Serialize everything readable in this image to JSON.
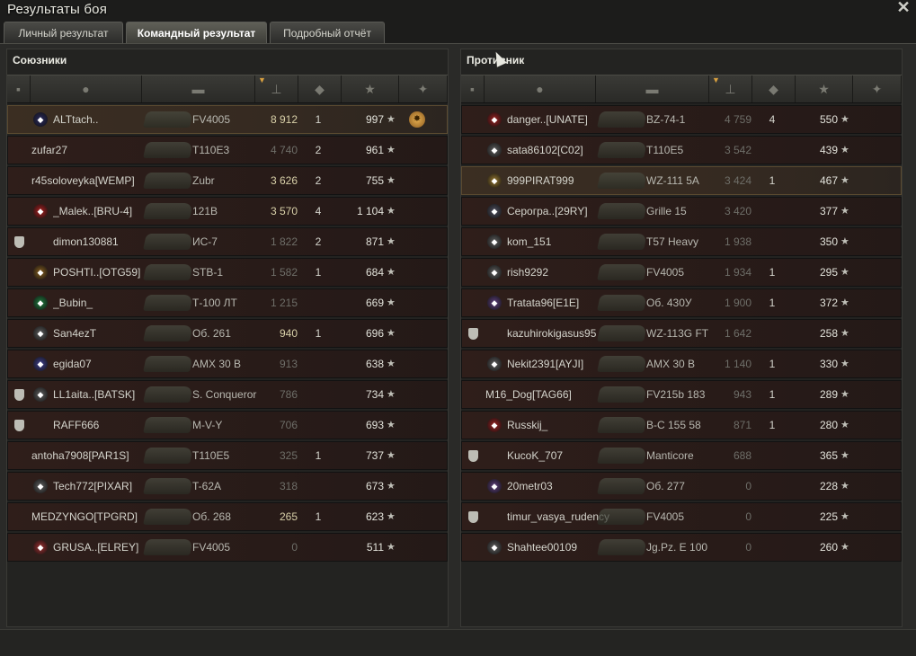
{
  "window": {
    "title": "Результаты боя",
    "close_icon": "close-icon"
  },
  "tabs": [
    {
      "label": "Личный результат",
      "active": false
    },
    {
      "label": "Командный результат",
      "active": true
    },
    {
      "label": "Подробный отчёт",
      "active": false
    }
  ],
  "allies": {
    "title": "Союзники",
    "rows": [
      {
        "squad": "",
        "clan_color": "#2a2a60",
        "name": "ALTtach..",
        "tank": "FV4005",
        "damage": "8 912",
        "kills": "1",
        "xp": "997",
        "medal": true,
        "dmg_bright": true,
        "highlight": true
      },
      {
        "squad": "",
        "clan_color": "",
        "name": "zufar27",
        "tank": "T110E3",
        "damage": "4 740",
        "kills": "2",
        "xp": "961",
        "medal": false,
        "dmg_bright": false
      },
      {
        "squad": "",
        "clan_color": "",
        "name": "r45soloveyka[WEMP]",
        "tank": "Zubr",
        "damage": "3 626",
        "kills": "2",
        "xp": "755",
        "medal": false,
        "dmg_bright": true
      },
      {
        "squad": "",
        "clan_color": "#b02020",
        "name": "_Malek..[BRU-4]",
        "tank": "121B",
        "damage": "3 570",
        "kills": "4",
        "xp": "1 104",
        "medal": false,
        "dmg_bright": true
      },
      {
        "squad": "sq",
        "clan_color": "",
        "name": "dimon130881",
        "tank": "ИС-7",
        "damage": "1 822",
        "kills": "2",
        "xp": "871",
        "medal": false,
        "dmg_bright": false
      },
      {
        "squad": "",
        "clan_color": "#8a6020",
        "name": "POSHTI..[OTG59]",
        "tank": "STB-1",
        "damage": "1 582",
        "kills": "1",
        "xp": "684",
        "medal": false,
        "dmg_bright": false
      },
      {
        "squad": "",
        "clan_color": "#208040",
        "name": "_Bubin_",
        "tank": "Т-100 ЛТ",
        "damage": "1 215",
        "kills": "",
        "xp": "669",
        "medal": false,
        "dmg_bright": false
      },
      {
        "squad": "",
        "clan_color": "#606060",
        "name": "San4ezT",
        "tank": "Об. 261",
        "damage": "940",
        "kills": "1",
        "xp": "696",
        "medal": false,
        "dmg_bright": true
      },
      {
        "squad": "",
        "clan_color": "#404090",
        "name": "egida07",
        "tank": "AMX 30 B",
        "damage": "913",
        "kills": "",
        "xp": "638",
        "medal": false,
        "dmg_bright": false
      },
      {
        "squad": "sq",
        "clan_color": "#606060",
        "name": "LL1aita..[BATSK]",
        "tank": "S. Conqueror",
        "damage": "786",
        "kills": "",
        "xp": "734",
        "medal": false,
        "dmg_bright": false
      },
      {
        "squad": "sq",
        "clan_color": "",
        "name": "RAFF666",
        "tank": "M-V-Y",
        "damage": "706",
        "kills": "",
        "xp": "693",
        "medal": false,
        "dmg_bright": false
      },
      {
        "squad": "",
        "clan_color": "",
        "name": "antoha7908[PAR1S]",
        "tank": "T110E5",
        "damage": "325",
        "kills": "1",
        "xp": "737",
        "medal": false,
        "dmg_bright": false
      },
      {
        "squad": "",
        "clan_color": "#606060",
        "name": "Tech772[PIXAR]",
        "tank": "T-62A",
        "damage": "318",
        "kills": "",
        "xp": "673",
        "medal": false,
        "dmg_bright": false
      },
      {
        "squad": "",
        "clan_color": "",
        "name": "MEDZYNGO[TPGRD]",
        "tank": "Об. 268",
        "damage": "265",
        "kills": "1",
        "xp": "623",
        "medal": false,
        "dmg_bright": true
      },
      {
        "squad": "",
        "clan_color": "#a03030",
        "name": "GRUSA..[ELREY]",
        "tank": "FV4005",
        "damage": "0",
        "kills": "",
        "xp": "511",
        "medal": false,
        "dmg_bright": false
      }
    ]
  },
  "enemies": {
    "title": "Противник",
    "rows": [
      {
        "squad": "",
        "clan_color": "#a02020",
        "name": "danger..[UNATE]",
        "tank": "BZ-74-1",
        "damage": "4 759",
        "kills": "4",
        "xp": "550",
        "medal": false,
        "dmg_bright": false
      },
      {
        "squad": "",
        "clan_color": "#606060",
        "name": "sata86102[C02]",
        "tank": "T110E5",
        "damage": "3 542",
        "kills": "",
        "xp": "439",
        "medal": false,
        "dmg_bright": false
      },
      {
        "squad": "",
        "clan_color": "#9a7a30",
        "name": "999PIRAT999",
        "tank": "WZ-111 5A",
        "damage": "3 424",
        "kills": "1",
        "xp": "467",
        "medal": false,
        "dmg_bright": false,
        "highlight": true
      },
      {
        "squad": "",
        "clan_color": "#505060",
        "name": "Серогра..[29RY]",
        "tank": "Grille 15",
        "damage": "3 420",
        "kills": "",
        "xp": "377",
        "medal": false,
        "dmg_bright": false
      },
      {
        "squad": "",
        "clan_color": "#606060",
        "name": "kom_151",
        "tank": "T57 Heavy",
        "damage": "1 938",
        "kills": "",
        "xp": "350",
        "medal": false,
        "dmg_bright": false
      },
      {
        "squad": "",
        "clan_color": "#606060",
        "name": "rish9292",
        "tank": "FV4005",
        "damage": "1 934",
        "kills": "1",
        "xp": "295",
        "medal": false,
        "dmg_bright": false
      },
      {
        "squad": "",
        "clan_color": "#604080",
        "name": "Tratata96[E1E]",
        "tank": "Об. 430У",
        "damage": "1 900",
        "kills": "1",
        "xp": "372",
        "medal": false,
        "dmg_bright": false
      },
      {
        "squad": "sq",
        "clan_color": "",
        "name": "kazuhirokigasus95",
        "tank": "WZ-113G FT",
        "damage": "1 642",
        "kills": "",
        "xp": "258",
        "medal": false,
        "dmg_bright": false
      },
      {
        "squad": "",
        "clan_color": "#606060",
        "name": "Nekit2391[AYJI]",
        "tank": "AMX 30 B",
        "damage": "1 140",
        "kills": "1",
        "xp": "330",
        "medal": false,
        "dmg_bright": false
      },
      {
        "squad": "",
        "clan_color": "",
        "name": "M16_Dog[TAG66]",
        "tank": "FV215b 183",
        "damage": "943",
        "kills": "1",
        "xp": "289",
        "medal": false,
        "dmg_bright": false
      },
      {
        "squad": "",
        "clan_color": "#a02020",
        "name": "Russkij_",
        "tank": "B-C 155 58",
        "damage": "871",
        "kills": "1",
        "xp": "280",
        "medal": false,
        "dmg_bright": false
      },
      {
        "squad": "sq",
        "clan_color": "",
        "name": "KucoK_707",
        "tank": "Manticore",
        "damage": "688",
        "kills": "",
        "xp": "365",
        "medal": false,
        "dmg_bright": false
      },
      {
        "squad": "",
        "clan_color": "#604080",
        "name": "20metr03",
        "tank": "Об. 277",
        "damage": "0",
        "kills": "",
        "xp": "228",
        "medal": false,
        "dmg_bright": false
      },
      {
        "squad": "sq",
        "clan_color": "",
        "name": "timur_vasya_rudency",
        "tank": "FV4005",
        "damage": "0",
        "kills": "",
        "xp": "225",
        "medal": false,
        "dmg_bright": false
      },
      {
        "squad": "",
        "clan_color": "#606060",
        "name": "Shahtee00109",
        "tank": "Jg.Pz. E 100",
        "damage": "0",
        "kills": "",
        "xp": "260",
        "medal": false,
        "dmg_bright": false
      }
    ]
  },
  "icons": {
    "star": "★",
    "squad_marker": "shield-icon",
    "medal": "medal-icon"
  }
}
